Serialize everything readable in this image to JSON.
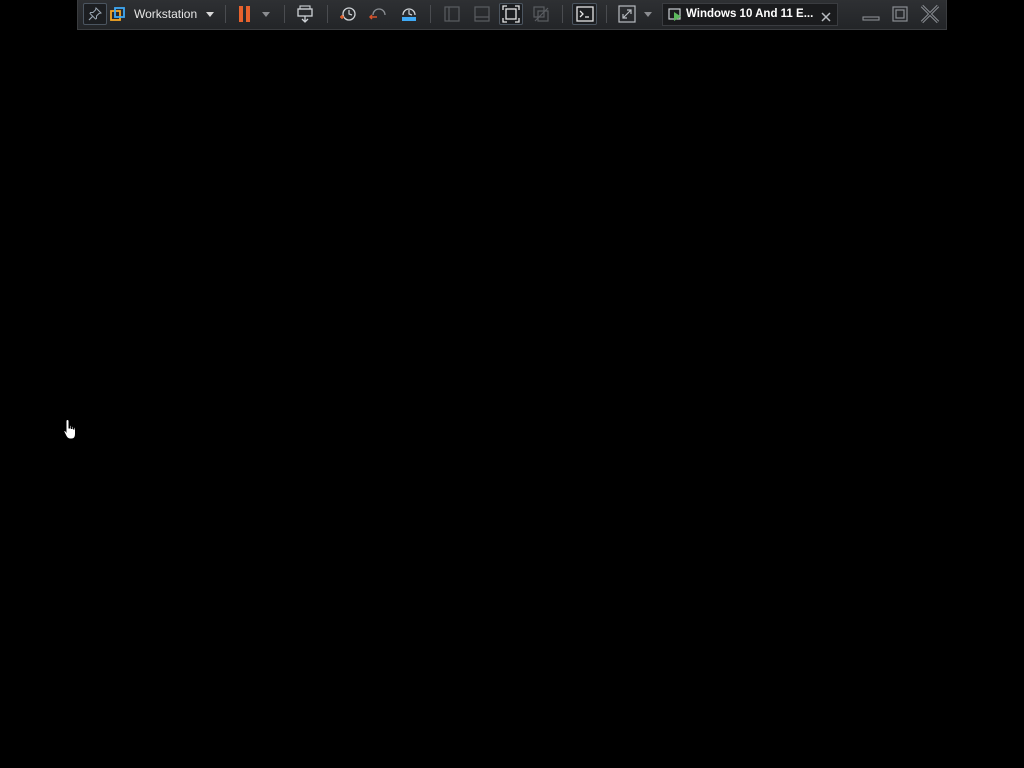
{
  "toolbar": {
    "library_menu_label": "Workstation",
    "vm_tab_title": "Windows 10 And 11 E...",
    "icons": {
      "pin": "pin-icon",
      "vmware_logo": "vmware-logo-icon",
      "workstation_dropdown": "chevron-down-icon",
      "pause": "pause-icon",
      "power_dropdown": "chevron-down-icon",
      "send_keys": "send-ctrl-alt-del-icon",
      "snapshot_take": "snapshot-take-icon",
      "snapshot_revert": "snapshot-revert-icon",
      "snapshot_manager": "snapshot-manager-icon",
      "view_library": "view-library-icon",
      "view_thumbnail": "view-thumbnail-icon",
      "full_screen": "full-screen-icon",
      "unity": "unity-icon",
      "console": "console-view-icon",
      "stretch": "stretch-guest-icon",
      "stretch_dropdown": "chevron-down-icon",
      "vm_tab": "vm-running-icon",
      "close_tab": "close-icon",
      "minimize": "minimize-icon",
      "restore": "restore-icon",
      "close_window": "close-window-icon"
    },
    "colors": {
      "pause_accent": "#e8622d",
      "vm_icon_green": "#5cb85c",
      "toolbar_bg": "#2a2c2f",
      "guest_screen": "#000000"
    }
  },
  "guest_screen": {
    "cursor": "hand-pointer-icon"
  }
}
